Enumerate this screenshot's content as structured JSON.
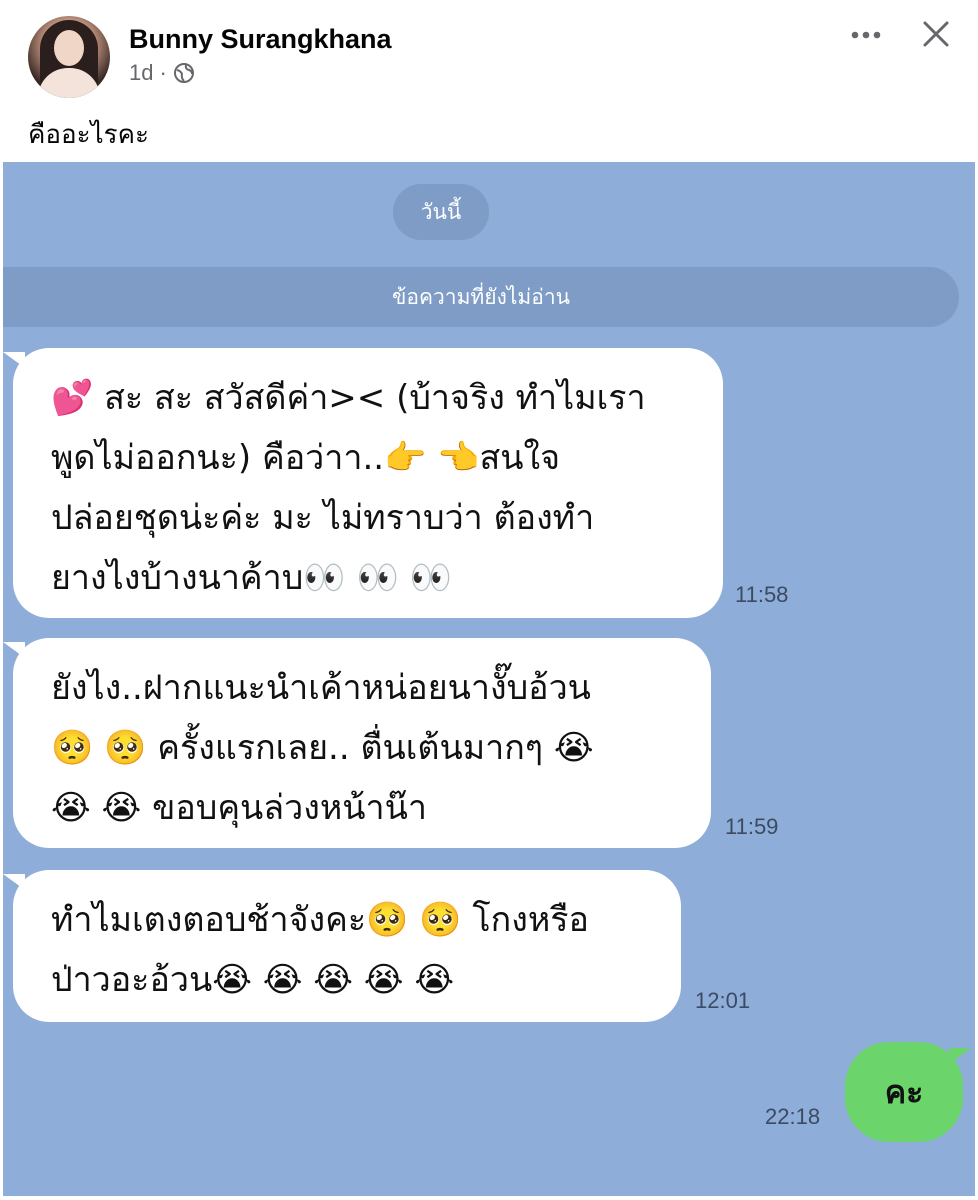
{
  "post": {
    "author": "Bunny Surangkhana",
    "time": "1d",
    "separator": "·",
    "caption": "คืออะไรคะ"
  },
  "icons": {
    "more": "more-horizontal-icon",
    "close": "close-icon",
    "audience": "globe-icon"
  },
  "chat": {
    "date_label": "วันนี้",
    "unread_label": "ข้อความที่ยังไม่อ่าน",
    "messages": [
      {
        "lines": [
          "💕 สะ สะ สวัสดีค่า>< (บ้าจริง ทำไมเรา",
          "พูดไม่ออกนะ) คือว่าา..👉 👈สนใจ",
          "ปล่อยชุดน่ะค่ะ มะ ไม่ทราบว่า ต้องทำ",
          "ยางไงบ้างนาค้าบ👀 👀 👀"
        ],
        "time": "11:58"
      },
      {
        "lines": [
          "ยังไง..ฝากแนะนำเค้าหน่อยนางั๊บอ้วน",
          "🥺 🥺 ครั้งแรกเลย.. ตื่นเต้นมากๆ 😭",
          "😭 😭 ขอบคุนล่วงหน้าน๊า"
        ],
        "time": "11:59"
      },
      {
        "lines": [
          "ทำไมเตงตอบช้าจังคะ🥺 🥺 โกงหรือ",
          "ป่าวอะอ้วน😭 😭 😭 😭 😭"
        ],
        "time": "12:01"
      }
    ],
    "outgoing": {
      "text": "คะ",
      "time": "22:18"
    }
  },
  "colors": {
    "chat_background": "#8eadd8",
    "pill": "#7f9cc6",
    "incoming_bubble": "#ffffff",
    "outgoing_bubble": "#6bd46b"
  }
}
